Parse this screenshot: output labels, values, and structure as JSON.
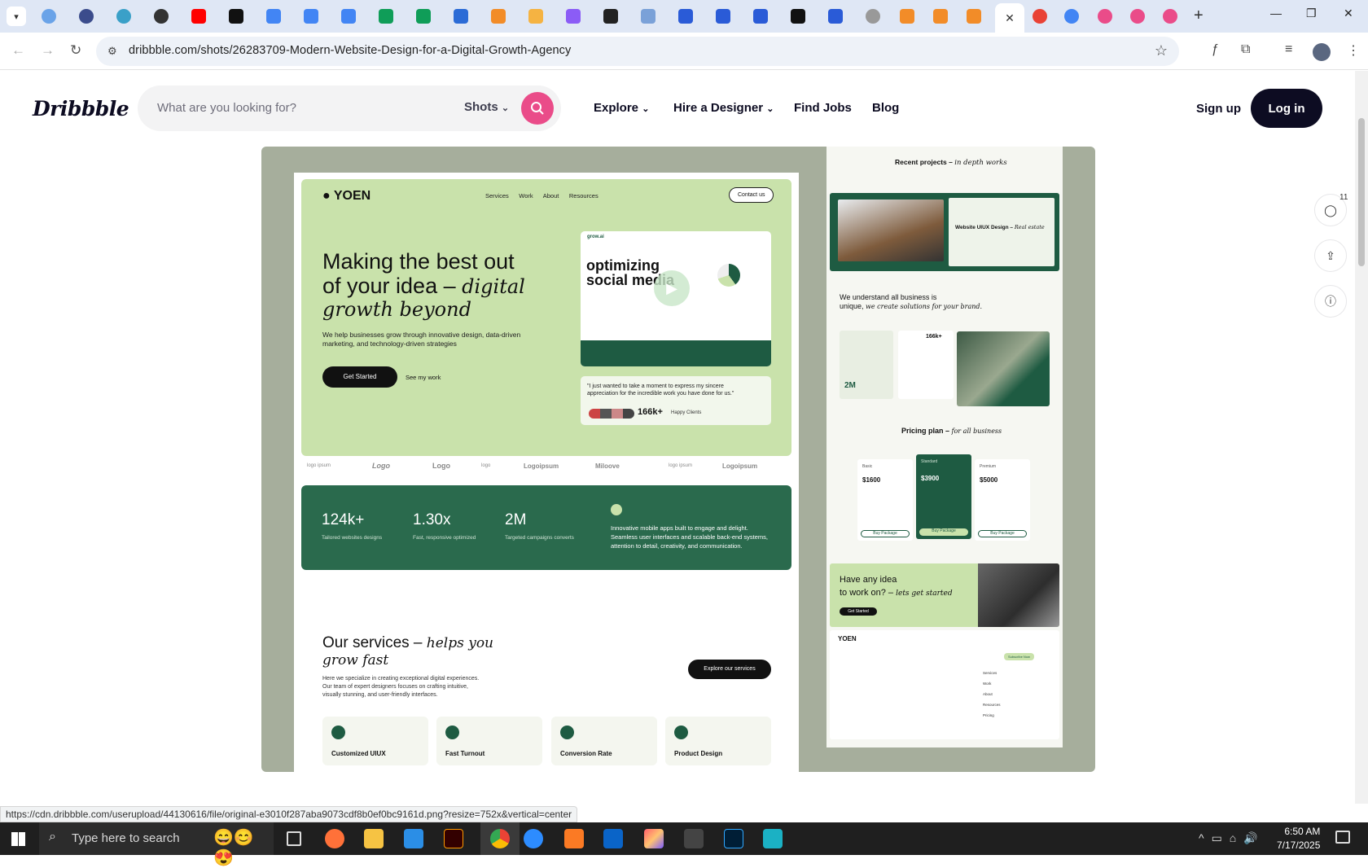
{
  "browser": {
    "active_tab_close": "✕",
    "new_tab": "+",
    "url": "dribbble.com/shots/26283709-Modern-Website-Design-for-a-Digital-Growth-Agency",
    "status_url": "https://cdn.dribbble.com/userupload/44130616/file/original-e3010f287aba9073cdf8b0ef0bc9161d.png?resize=752x&vertical=center"
  },
  "header": {
    "logo": "Dribbble",
    "search_placeholder": "What are you looking for?",
    "search_filter": "Shots",
    "nav": [
      "Explore",
      "Hire a Designer",
      "Find Jobs",
      "Blog"
    ],
    "sign_up": "Sign up",
    "log_in": "Log in"
  },
  "side_actions": {
    "comments_count": "11"
  },
  "shot": {
    "brand": "YOEN",
    "nav": [
      "Services",
      "Work",
      "About",
      "Resources"
    ],
    "contact": "Contact us",
    "hero_title_1": "Making the best out",
    "hero_title_2": "of your idea –",
    "hero_title_italic_1": "digital",
    "hero_title_italic_2": "growth beyond",
    "hero_text_1": "We help businesses grow through innovative design, data-driven",
    "hero_text_2": "marketing, and technology-driven strategies",
    "get_started": "Get Started",
    "see_work": "See my work",
    "mock_brand": "grow.ai",
    "mock_title_1": "optimizing",
    "mock_title_2": "social media",
    "quote_1": "\"I just wanted to take a moment to express my sincere",
    "quote_2": "appreciation for the incredible work you have done for us.\"",
    "clients_count": "166k+",
    "clients_label": "Happy Clients",
    "logos": [
      "logo ipsum",
      "Logo",
      "Logo",
      "logo",
      "Logoipsum",
      "Miloove",
      "logo ipsum",
      "Logoipsum"
    ],
    "stats": [
      {
        "value": "124k+",
        "label": "Tailored websites designs"
      },
      {
        "value": "1.30x",
        "label": "Fast, responsive optimized"
      },
      {
        "value": "2M",
        "label": "Targeted campaigns converts"
      }
    ],
    "stats_text_1": "Innovative mobile apps built to engage and delight.",
    "stats_text_2": "Seamless user interfaces and scalable back-end systems,",
    "stats_text_3": "attention to detail, creativity, and communication.",
    "services_title": "Our services –",
    "services_italic_1": "helps you",
    "services_italic_2": "grow fast",
    "services_text_1": "Here we specialize in creating exceptional digital experiences.",
    "services_text_2": "Our team of expert designers focuses on crafting intuitive,",
    "services_text_3": "visually stunning, and user-friendly interfaces.",
    "explore_services": "Explore our services",
    "service_cards": [
      "Customized UIUX",
      "Fast Turnout",
      "Conversion Rate",
      "Product Design"
    ],
    "side": {
      "recent_title": "Recent projects –",
      "recent_italic": "in depth works",
      "project_title": "Website UIUX Design –",
      "project_italic": "Real estate",
      "unique_1": "We understand all business is",
      "unique_2": "unique,",
      "unique_italic": "we create solutions for your brand.",
      "stat_2m": "2M",
      "stat_166k": "166k+",
      "pricing_title": "Pricing plan –",
      "pricing_italic": "for all business",
      "plans": [
        {
          "name": "Basic",
          "price": "$1600",
          "button": "Buy Package"
        },
        {
          "name": "Standard",
          "price": "$3900",
          "button": "Buy Package"
        },
        {
          "name": "Premium",
          "price": "$5000",
          "button": "Buy Package"
        }
      ],
      "cta_1": "Have any idea",
      "cta_2": "to work on? –",
      "cta_italic": "lets get started",
      "cta_button": "Get Started",
      "footer_brand": "YOEN",
      "footer_links": [
        "Services",
        "Work",
        "About",
        "Resources",
        "Pricing"
      ],
      "subscribe": "Subscribe Now"
    }
  },
  "taskbar": {
    "search_placeholder": "Type here to search",
    "time": "6:50 AM",
    "date": "7/17/2025"
  },
  "colors": {
    "brand_pink": "#ea4c89",
    "dark": "#0d0c22",
    "hero_green": "#c9e2ab",
    "deep_green": "#1e5b42"
  }
}
